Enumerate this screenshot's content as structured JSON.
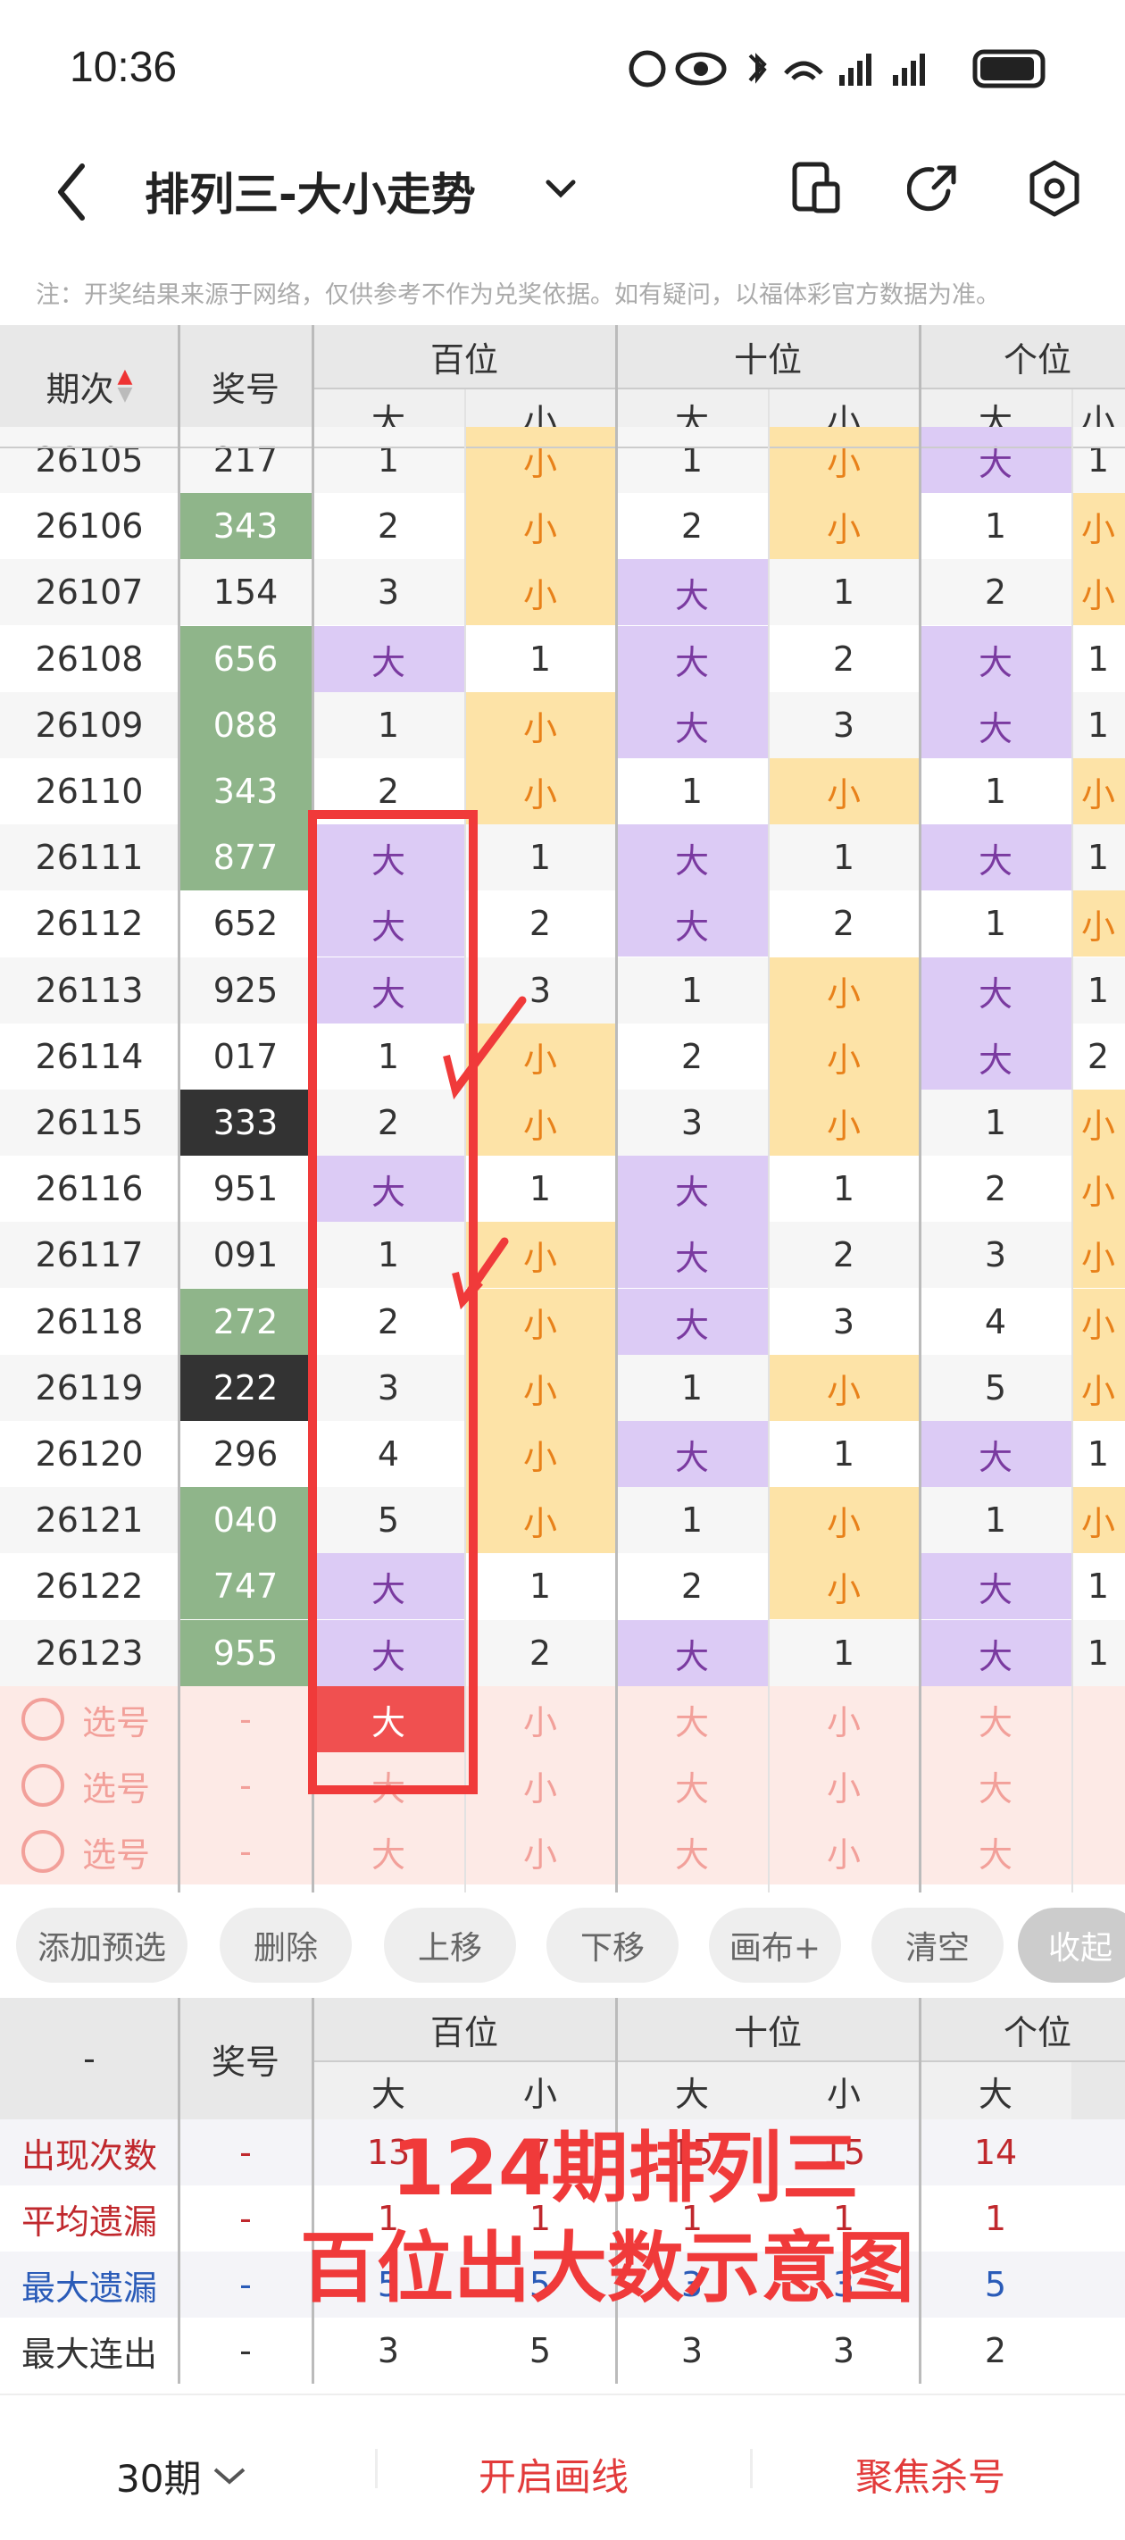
{
  "status": {
    "time": "10:36"
  },
  "header": {
    "title": "排列三-大小走势"
  },
  "note": "注：开奖结果来源于网络，仅供参考不作为兑奖依据。如有疑问，以福体彩官方数据为准。",
  "table_head": {
    "period": "期次",
    "prize": "奖号",
    "hundreds": "百位",
    "tens": "十位",
    "units": "个位",
    "big": "大",
    "small": "小"
  },
  "rows": [
    {
      "p": "26105",
      "n": "217",
      "t": "w",
      "c": [
        "1",
        "小",
        "1",
        "小",
        "大",
        "1"
      ]
    },
    {
      "p": "26106",
      "n": "343",
      "t": "g",
      "c": [
        "2",
        "小",
        "2",
        "小",
        "1",
        "小"
      ]
    },
    {
      "p": "26107",
      "n": "154",
      "t": "w",
      "c": [
        "3",
        "小",
        "大",
        "1",
        "2",
        "小"
      ]
    },
    {
      "p": "26108",
      "n": "656",
      "t": "g",
      "c": [
        "大",
        "1",
        "大",
        "2",
        "大",
        "1"
      ]
    },
    {
      "p": "26109",
      "n": "088",
      "t": "g",
      "c": [
        "1",
        "小",
        "大",
        "3",
        "大",
        "1"
      ]
    },
    {
      "p": "26110",
      "n": "343",
      "t": "g",
      "c": [
        "2",
        "小",
        "1",
        "小",
        "1",
        "小"
      ]
    },
    {
      "p": "26111",
      "n": "877",
      "t": "g",
      "c": [
        "大",
        "1",
        "大",
        "1",
        "大",
        "1"
      ]
    },
    {
      "p": "26112",
      "n": "652",
      "t": "w",
      "c": [
        "大",
        "2",
        "大",
        "2",
        "1",
        "小"
      ]
    },
    {
      "p": "26113",
      "n": "925",
      "t": "w",
      "c": [
        "大",
        "3",
        "1",
        "小",
        "大",
        "1"
      ]
    },
    {
      "p": "26114",
      "n": "017",
      "t": "w",
      "c": [
        "1",
        "小",
        "2",
        "小",
        "大",
        "2"
      ]
    },
    {
      "p": "26115",
      "n": "333",
      "t": "b",
      "c": [
        "2",
        "小",
        "3",
        "小",
        "1",
        "小"
      ]
    },
    {
      "p": "26116",
      "n": "951",
      "t": "w",
      "c": [
        "大",
        "1",
        "大",
        "1",
        "2",
        "小"
      ]
    },
    {
      "p": "26117",
      "n": "091",
      "t": "w",
      "c": [
        "1",
        "小",
        "大",
        "2",
        "3",
        "小"
      ]
    },
    {
      "p": "26118",
      "n": "272",
      "t": "g",
      "c": [
        "2",
        "小",
        "大",
        "3",
        "4",
        "小"
      ]
    },
    {
      "p": "26119",
      "n": "222",
      "t": "b",
      "c": [
        "3",
        "小",
        "1",
        "小",
        "5",
        "小"
      ]
    },
    {
      "p": "26120",
      "n": "296",
      "t": "w",
      "c": [
        "4",
        "小",
        "大",
        "1",
        "大",
        "1"
      ]
    },
    {
      "p": "26121",
      "n": "040",
      "t": "g",
      "c": [
        "5",
        "小",
        "1",
        "小",
        "1",
        "小"
      ]
    },
    {
      "p": "26122",
      "n": "747",
      "t": "g",
      "c": [
        "大",
        "1",
        "2",
        "小",
        "大",
        "1"
      ]
    },
    {
      "p": "26123",
      "n": "955",
      "t": "g",
      "c": [
        "大",
        "2",
        "大",
        "1",
        "大",
        "1"
      ]
    }
  ],
  "pick_rows": [
    {
      "label": "选号",
      "dash": "-",
      "c": [
        "大",
        "小",
        "大",
        "小",
        "大"
      ]
    },
    {
      "label": "选号",
      "dash": "-",
      "c": [
        "大",
        "小",
        "大",
        "小",
        "大"
      ]
    },
    {
      "label": "选号",
      "dash": "-",
      "c": [
        "大",
        "小",
        "大",
        "小",
        "大"
      ]
    }
  ],
  "actions": [
    "添加预选",
    "删除",
    "上移",
    "下移",
    "画布+",
    "清空",
    "收起"
  ],
  "stats_head": {
    "dash": "-",
    "prize": "奖号"
  },
  "stats": [
    {
      "label": "出现次数",
      "dash": "-",
      "c": [
        "13",
        "7",
        "15",
        "15",
        "14"
      ],
      "color": "#c0282d"
    },
    {
      "label": "平均遗漏",
      "dash": "-",
      "c": [
        "1",
        "1",
        "1",
        "1",
        "1"
      ],
      "color": "#c0282d"
    },
    {
      "label": "最大遗漏",
      "dash": "-",
      "c": [
        "5",
        "5",
        "3",
        "3",
        "5"
      ],
      "color": "#2a5bb8"
    },
    {
      "label": "最大连出",
      "dash": "-",
      "c": [
        "3",
        "5",
        "3",
        "3",
        "2"
      ],
      "color": "#333"
    }
  ],
  "overlay": {
    "line1": "124期排列三",
    "line2": "百位出大数示意图"
  },
  "bottom": {
    "periods": "30期",
    "draw": "开启画线",
    "focus": "聚焦杀号"
  }
}
